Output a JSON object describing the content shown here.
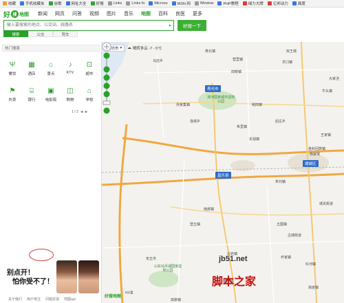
{
  "bookmarks": [
    {
      "icon": "star-icon",
      "label": "收藏"
    },
    {
      "icon": "phone-icon",
      "label": "手机收藏夹"
    },
    {
      "icon": "google-icon",
      "label": "谷歌"
    },
    {
      "icon": "page-icon",
      "label": "网址大全"
    },
    {
      "icon": "page-icon",
      "label": "好搜"
    },
    {
      "icon": "link-icon",
      "label": "Links"
    },
    {
      "icon": "link-icon",
      "label": "Links fo"
    },
    {
      "icon": "ms-icon",
      "label": "Microso"
    },
    {
      "icon": "msn-icon",
      "label": "MSN 网"
    },
    {
      "icon": "window-icon",
      "label": "Window"
    },
    {
      "icon": "php-icon",
      "label": "PHP教程"
    },
    {
      "icon": "page-icon",
      "label": "绿力大牌"
    },
    {
      "icon": "page-icon",
      "label": "亿邦动力"
    },
    {
      "icon": "page-icon",
      "label": "面度"
    }
  ],
  "header": {
    "logo_hao": "好",
    "logo_circle": "搜",
    "logo_map": "地图",
    "nav": [
      "新闻",
      "网页",
      "问答",
      "视频",
      "图片",
      "音乐",
      "地图",
      "百科",
      "良医",
      "更多"
    ],
    "active_nav": "地图",
    "search_placeholder": "输入要搜索的地点、公交站、线路名",
    "search_button": "好搜一下",
    "mode_tabs": [
      "搜索",
      "公交",
      "驾车"
    ],
    "active_mode": "搜索"
  },
  "left": {
    "hot_title": "热门搜索",
    "categories": [
      {
        "icon": "dining-icon",
        "label": "餐饮"
      },
      {
        "icon": "hotel-icon",
        "label": "酒店"
      },
      {
        "icon": "scenic-icon",
        "label": "景点"
      },
      {
        "icon": "ktv-icon",
        "label": "KTV"
      },
      {
        "icon": "supermarket-icon",
        "label": "超市"
      },
      {
        "icon": "takeout-icon",
        "label": "外卖"
      },
      {
        "icon": "bank-icon",
        "label": "银行"
      },
      {
        "icon": "cinema-icon",
        "label": "电影院"
      },
      {
        "icon": "shopping-icon",
        "label": "购物"
      },
      {
        "icon": "school-icon",
        "label": "学校"
      }
    ],
    "pager": "1 / 2",
    "ad_line1": "别点开！",
    "ad_line2": "怕你受不了！",
    "footer": [
      "关于我们",
      "用户电注",
      "问题反馈",
      "地图api"
    ]
  },
  "map": {
    "city": "潍坊市",
    "weather": "晴转多云 -7 - 5℃",
    "city_tags": [
      "寿光市",
      "潍城区",
      "昌乐县"
    ],
    "labels": [
      "马店乡",
      "营里镇",
      "羊口镇",
      "孙家集镇",
      "稻田镇",
      "洛城乡",
      "后庄乡",
      "王家镇",
      "大家洼",
      "双王城",
      "田柳镇",
      "牛头镇",
      "寿北镇",
      "东钱镇",
      "金岭回族镇",
      "杨家埠",
      "朱刘镇",
      "南郝镇",
      "营丘镇",
      "五图镇",
      "乔官镇",
      "红河镇",
      "安丘市",
      "鄌郚镇",
      "城关街道",
      "高崖镇",
      "古城街道",
      "北岩镇",
      "朱里镇",
      "高柳镇"
    ],
    "parks": [
      "滨河国家城市湿地公园",
      "山东仙月湖国家湿地公园"
    ],
    "scale_label": "5公里",
    "map_logo": "好搜地图",
    "watermark_url": "jb51.net",
    "watermark": "脚本之家"
  }
}
